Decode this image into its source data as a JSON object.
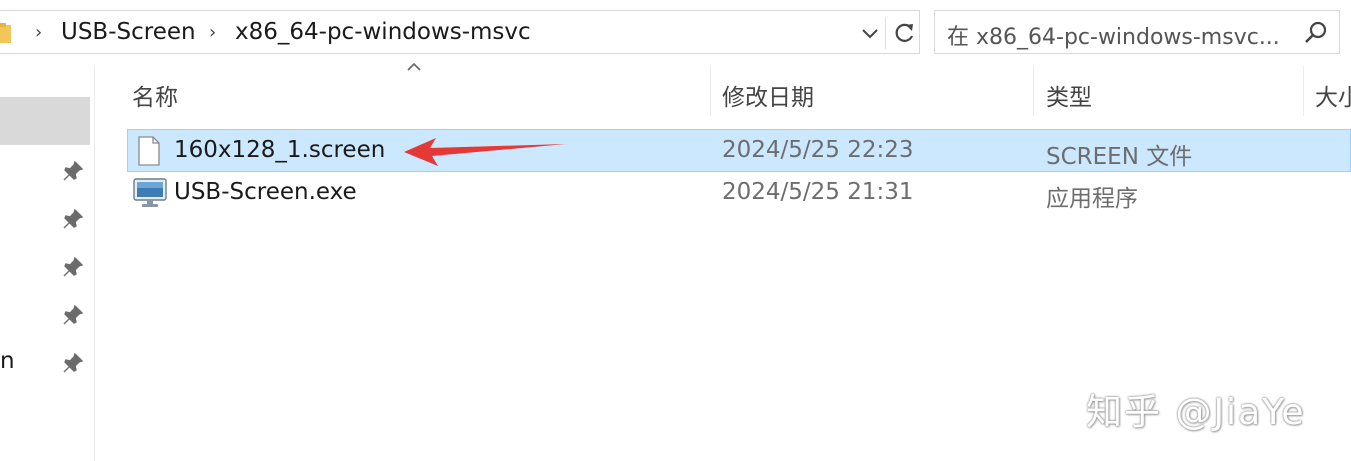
{
  "address_bar": {
    "breadcrumbs": [
      "USB-Screen",
      "x86_64-pc-windows-msvc"
    ]
  },
  "search": {
    "placeholder": "在 x86_64-pc-windows-msvc..."
  },
  "sidebar": {
    "partial_item_text": "n",
    "pinned_items": 5
  },
  "columns": {
    "name": "名称",
    "modified": "修改日期",
    "type": "类型",
    "size": "大小"
  },
  "files": [
    {
      "name": "160x128_1.screen",
      "modified": "2024/5/25 22:23",
      "type": "SCREEN 文件",
      "icon": "blank-file-icon",
      "selected": true
    },
    {
      "name": "USB-Screen.exe",
      "modified": "2024/5/25 21:31",
      "type": "应用程序",
      "icon": "monitor-app-icon",
      "selected": false
    }
  ],
  "colors": {
    "selection_fill": "#cce8ff",
    "selection_border": "#99d1ff",
    "annotation_arrow": "#e53935"
  },
  "watermark": "知乎 @JiaYe"
}
